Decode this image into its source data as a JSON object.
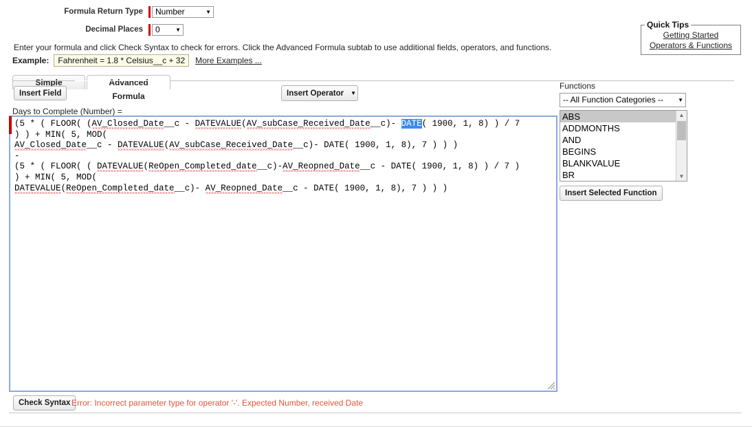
{
  "form": {
    "return_type_label": "Formula Return Type",
    "return_type_value": "Number",
    "decimal_places_label": "Decimal Places",
    "decimal_places_value": "0",
    "helper_text": "Enter your formula and click Check Syntax to check for errors. Click the Advanced Formula subtab to use additional fields, operators, and functions.",
    "example_label": "Example:",
    "example_value": "Fahrenheit = 1.8 * Celsius__c + 32",
    "more_examples_label": "More Examples ...",
    "caret_glyph": "▼"
  },
  "quick_tips": {
    "legend": "Quick Tips",
    "links": [
      "Getting Started",
      "Operators & Functions"
    ]
  },
  "tabs": [
    {
      "label": "Simple Formula",
      "active": false
    },
    {
      "label": "Advanced Formula",
      "active": true
    }
  ],
  "toolbar": {
    "insert_field_label": "Insert Field",
    "insert_operator_label": "Insert Operator"
  },
  "formula": {
    "label": "Days to Complete (Number) =",
    "selected_token": "DATE",
    "lines": [
      "(5 * ( FLOOR( (AV_Closed_Date__c - DATEVALUE(AV_subCase_Received_Date__c)- DATE( 1900, 1, 8) ) / 7",
      ") ) + MIN( 5, MOD(",
      "AV_Closed_Date__c - DATEVALUE(AV_subCase_Received_Date__c)- DATE( 1900, 1, 8), 7 ) ) )",
      "-",
      "(5 * ( FLOOR( ( DATEVALUE(ReOpen_Completed_date__c)-AV_Reopned_Date__c - DATE( 1900, 1, 8) ) / 7 )",
      ") + MIN( 5, MOD(",
      "DATEVALUE(ReOpen_Completed_date__c)- AV_Reopned_Date__c - DATE( 1900, 1, 8), 7 ) ) )"
    ]
  },
  "functions": {
    "title": "Functions",
    "category_value": "-- All Function Categories --",
    "items": [
      "ABS",
      "ADDMONTHS",
      "AND",
      "BEGINS",
      "BLANKVALUE",
      "BR"
    ],
    "selected_item": "ABS",
    "insert_button_label": "Insert Selected Function",
    "scroll_up_glyph": "▲",
    "scroll_down_glyph": "▼"
  },
  "footer": {
    "check_syntax_label": "Check Syntax",
    "error_message": "Error: Incorrect parameter type for operator '-'. Expected Number, received Date",
    "error_color": "#e0563c"
  }
}
